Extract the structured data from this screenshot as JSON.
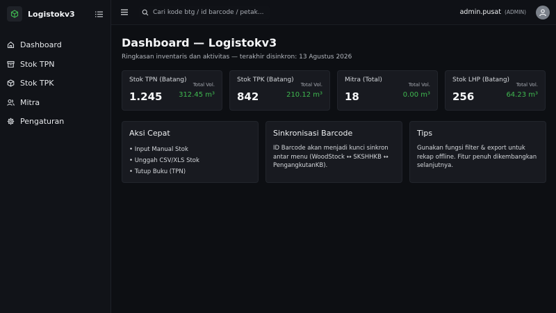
{
  "brand": {
    "name": "Logistokv3",
    "icon": "cube-icon",
    "accent": "#3fb950"
  },
  "sidebar": {
    "items": [
      {
        "label": "Dashboard",
        "icon": "home-icon"
      },
      {
        "label": "Stok TPN",
        "icon": "archive-icon"
      },
      {
        "label": "Stok TPK",
        "icon": "box-icon"
      },
      {
        "label": "Mitra",
        "icon": "users-icon"
      },
      {
        "label": "Pengaturan",
        "icon": "gear-icon"
      }
    ]
  },
  "topbar": {
    "search_placeholder": "Cari kode btg / id barcode / petak...",
    "user": {
      "name": "admin.pusat",
      "role": "(ADMIN)"
    }
  },
  "page": {
    "title": "Dashboard — Logistokv3",
    "subtitle": "Ringkasan inventaris dan aktivitas — terakhir disinkron: 13 Agustus 2026"
  },
  "stats": [
    {
      "label": "Stok TPN (Batang)",
      "vol_label": "Total Vol.",
      "value": "1.245",
      "vol": "312.45 m³"
    },
    {
      "label": "Stok TPK (Batang)",
      "vol_label": "Total Vol.",
      "value": "842",
      "vol": "210.12 m³"
    },
    {
      "label": "Mitra (Total)",
      "vol_label": "Total Vol.",
      "value": "18",
      "vol": "0.00 m³"
    },
    {
      "label": "Stok LHP (Batang)",
      "vol_label": "Total Vol.",
      "value": "256",
      "vol": "64.23 m³"
    }
  ],
  "panels": {
    "quick": {
      "title": "Aksi Cepat",
      "items": [
        "• Input Manual Stok",
        "• Unggah CSV/XLS Stok",
        "• Tutup Buku (TPN)"
      ]
    },
    "sync": {
      "title": "Sinkronisasi Barcode",
      "text": "ID Barcode akan menjadi kunci sinkron antar menu (WoodStock ↔ SKSHHKB ↔ PengangkutanKB)."
    },
    "tips": {
      "title": "Tips",
      "text": "Gunakan fungsi filter & export untuk rekap offline. Fitur penuh dikembangkan selanjutnya."
    }
  }
}
